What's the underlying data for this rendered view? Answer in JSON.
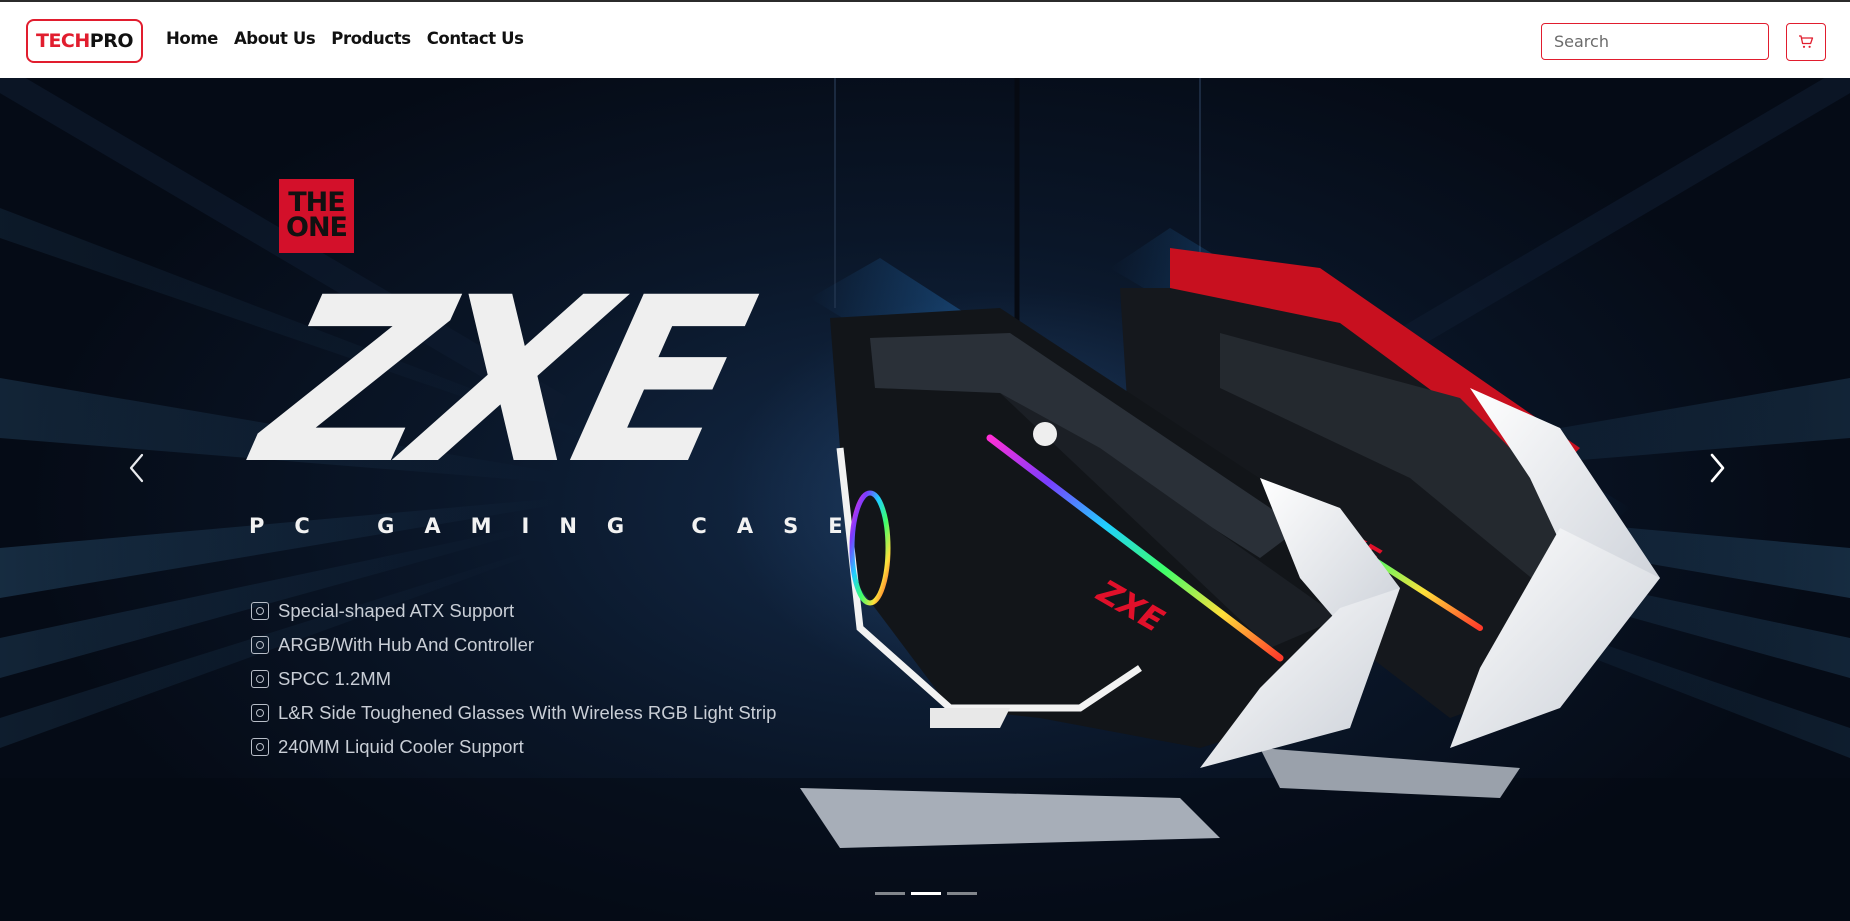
{
  "navbar": {
    "brand": {
      "part1": "TECH",
      "part2": "PRO",
      "accent_color": "#e11d2e"
    },
    "links": [
      "Home",
      "About Us",
      "Products",
      "Contact Us"
    ],
    "search": {
      "placeholder": "Search",
      "value": ""
    },
    "cart_icon": "shopping-cart-icon"
  },
  "hero": {
    "logo": {
      "line1": "THE",
      "line2": "ONE",
      "color": "#d3102a"
    },
    "title": "ZXE",
    "subtitle": "PC GAMING CASE",
    "features": [
      {
        "icon": "motherboard-icon",
        "text": "Special-shaped ATX Support"
      },
      {
        "icon": "fan-icon",
        "text": "ARGB/With Hub And Controller"
      },
      {
        "icon": "steel-icon",
        "text": "SPCC 1.2MM"
      },
      {
        "icon": "glass-icon",
        "text": "L&R Side Toughened Glasses With Wireless RGB Light Strip"
      },
      {
        "icon": "cooler-icon",
        "text": "240MM Liquid Cooler Support"
      }
    ],
    "carousel": {
      "prev_icon": "chevron-left-icon",
      "next_icon": "chevron-right-icon",
      "slides": 3,
      "active_slide": 2
    }
  }
}
